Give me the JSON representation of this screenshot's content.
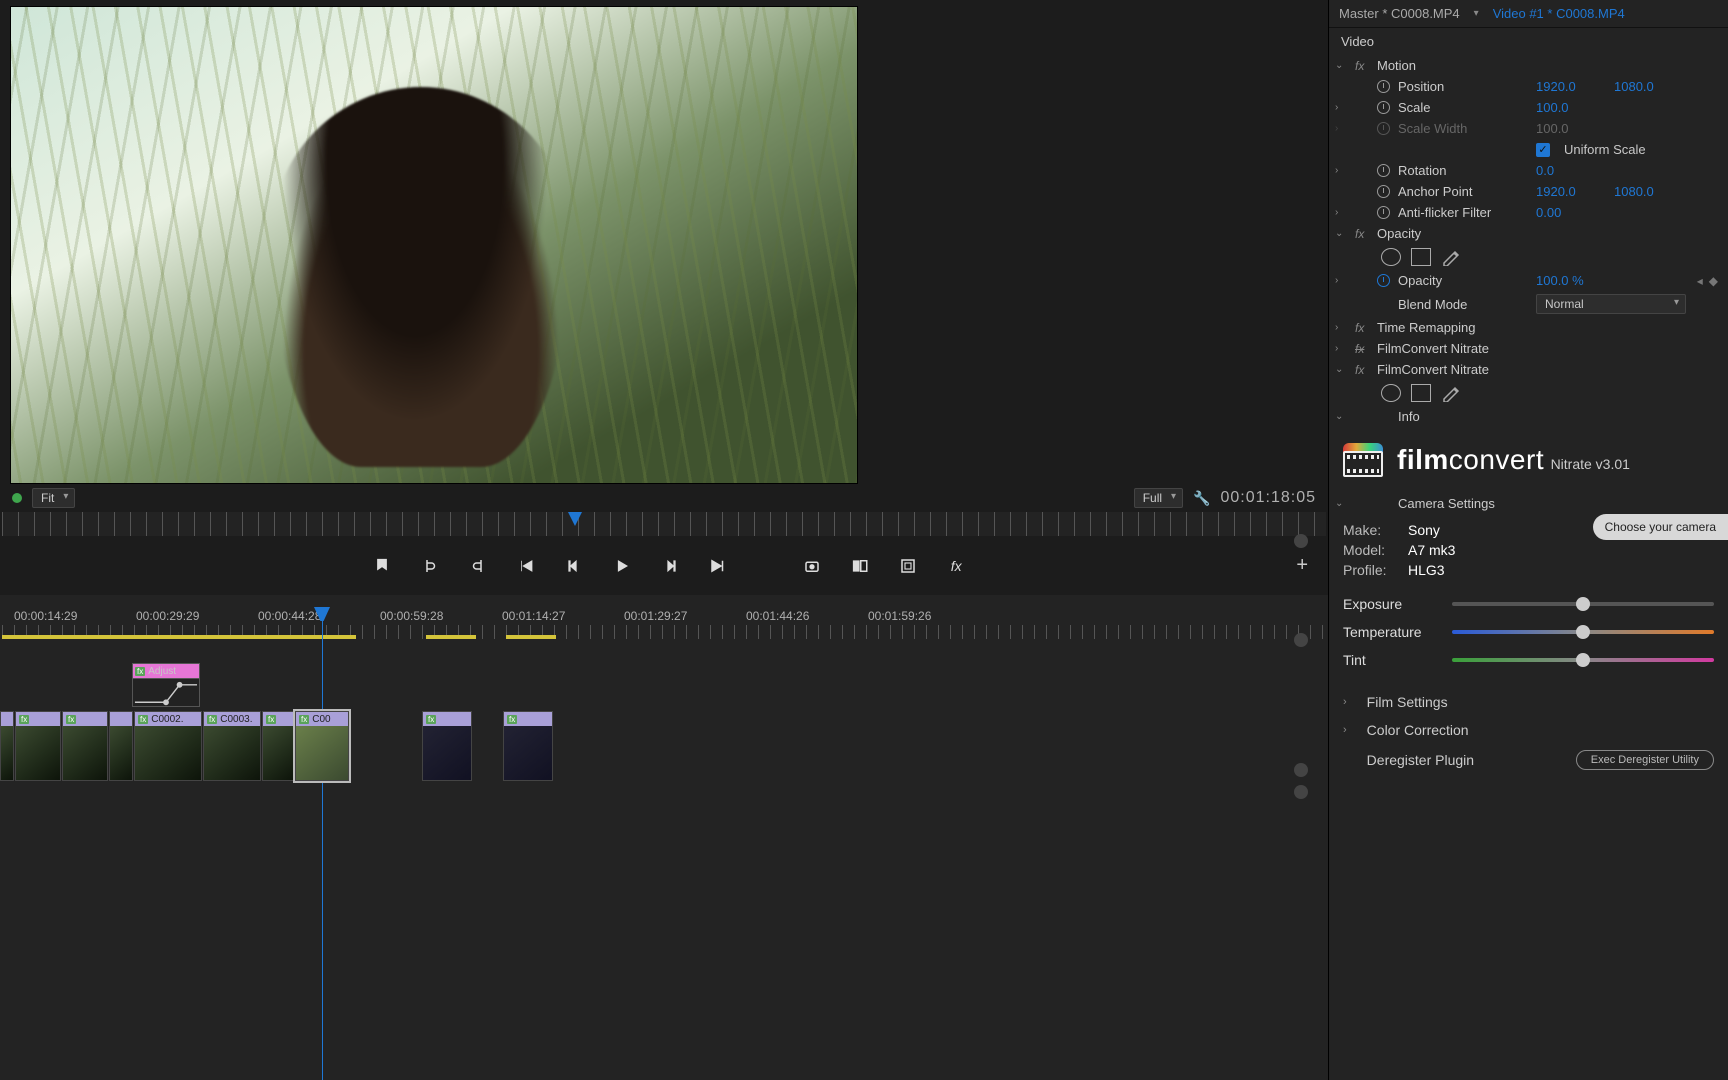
{
  "tabs": {
    "master": "Master * C0008.MP4",
    "video": "Video #1 * C0008.MP4"
  },
  "sectionVideo": "Video",
  "motion": {
    "label": "Motion",
    "position": {
      "label": "Position",
      "x": "1920.0",
      "y": "1080.0"
    },
    "scale": {
      "label": "Scale",
      "val": "100.0"
    },
    "scaleWidth": {
      "label": "Scale Width",
      "val": "100.0"
    },
    "uniform": {
      "label": "Uniform Scale"
    },
    "rotation": {
      "label": "Rotation",
      "val": "0.0"
    },
    "anchor": {
      "label": "Anchor Point",
      "x": "1920.0",
      "y": "1080.0"
    },
    "antiflicker": {
      "label": "Anti-flicker Filter",
      "val": "0.00"
    }
  },
  "opacity": {
    "label": "Opacity",
    "val": {
      "label": "Opacity",
      "value": "100.0 %"
    },
    "blend": {
      "label": "Blend Mode",
      "value": "Normal"
    }
  },
  "timeRemap": "Time Remapping",
  "fcNitrateA": "FilmConvert Nitrate",
  "fcNitrateB": "FilmConvert Nitrate",
  "info": "Info",
  "fclogo": {
    "brand1": "film",
    "brand2": "convert",
    "sub": "Nitrate v3.01"
  },
  "camera": {
    "heading": "Camera Settings",
    "make": {
      "k": "Make:",
      "v": "Sony"
    },
    "model": {
      "k": "Model:",
      "v": "A7 mk3"
    },
    "profile": {
      "k": "Profile:",
      "v": "HLG3"
    },
    "button": "Choose your camera"
  },
  "sliders": {
    "exposure": "Exposure",
    "temperature": "Temperature",
    "tint": "Tint"
  },
  "fcsections": {
    "film": "Film Settings",
    "color": "Color Correction",
    "dereg": "Deregister Plugin",
    "deregbtn": "Exec Deregister Utility"
  },
  "viewer": {
    "fit": "Fit",
    "full": "Full",
    "tc": "00:01:18:05"
  },
  "timelabels": [
    "00:00:14:29",
    "00:00:29:29",
    "00:00:44:28",
    "00:00:59:28",
    "00:01:14:27",
    "00:01:29:27",
    "00:01:44:26",
    "00:01:59:26"
  ],
  "adjust": "Adjust",
  "clips": [
    "",
    "",
    "",
    "C0002.",
    "C0003.",
    "",
    "C00",
    "",
    ""
  ]
}
